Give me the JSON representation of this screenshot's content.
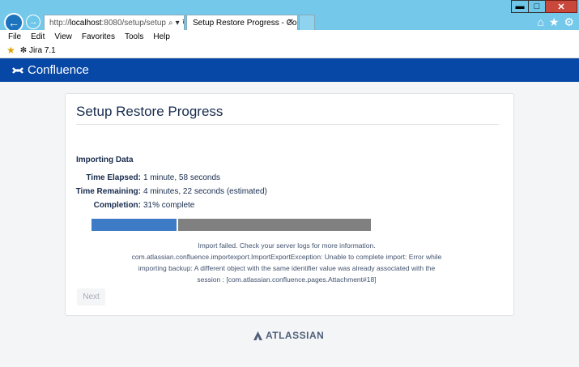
{
  "browser": {
    "address_scheme": "http://",
    "address_host": "localhost",
    "address_path": ":8080/setup/setup",
    "tab_title": "Setup Restore Progress - Co...",
    "menu": [
      "File",
      "Edit",
      "View",
      "Favorites",
      "Tools",
      "Help"
    ],
    "favorites": [
      {
        "label": "Jira 7.1"
      }
    ],
    "window_controls": {
      "minimize": "▬",
      "maximize": "□",
      "close": "✕"
    }
  },
  "header": {
    "product": "Confluence"
  },
  "main": {
    "title": "Setup Restore Progress",
    "section_title": "Importing Data",
    "time_elapsed_label": "Time Elapsed:",
    "time_elapsed_value": "1 minute, 58 seconds",
    "time_remaining_label": "Time Remaining:",
    "time_remaining_value": "4 minutes, 22 seconds (estimated)",
    "completion_label": "Completion:",
    "completion_value": "31% complete",
    "progress_fraction": 0.31,
    "error_lines": [
      "Import failed. Check your server logs for more information.",
      "com.atlassian.confluence.importexport.ImportExportException: Unable to complete import: Error while",
      "importing backup: A different object with the same identifier value was already associated with the",
      "session : [com.atlassian.confluence.pages.Attachment#18]"
    ],
    "next_label": "Next"
  },
  "footer": {
    "brand": "ATLASSIAN"
  },
  "colors": {
    "header_bg": "#0747a6",
    "progress_fill": "#3d7bc6",
    "progress_track": "#808080"
  }
}
